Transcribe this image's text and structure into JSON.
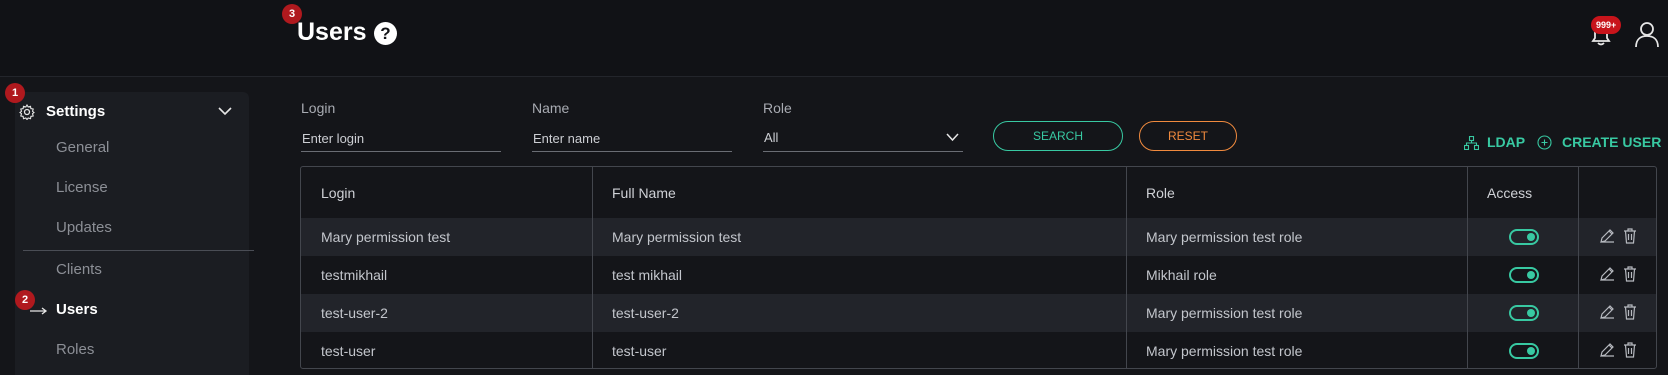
{
  "header": {
    "title": "Users",
    "notifications_count": "999+"
  },
  "annotations": [
    "1",
    "2",
    "3"
  ],
  "sidebar": {
    "section_title": "Settings",
    "items": [
      {
        "label": "General"
      },
      {
        "label": "License"
      },
      {
        "label": "Updates"
      },
      {
        "label": "Clients"
      },
      {
        "label": "Users"
      },
      {
        "label": "Roles"
      }
    ]
  },
  "filters": {
    "login_label": "Login",
    "login_placeholder": "Enter login",
    "name_label": "Name",
    "name_placeholder": "Enter name",
    "role_label": "Role",
    "role_value": "All",
    "search_label": "SEARCH",
    "reset_label": "RESET"
  },
  "actions": {
    "ldap_label": "LDAP",
    "create_user_label": "CREATE USER"
  },
  "table": {
    "columns": [
      "Login",
      "Full Name",
      "Role",
      "Access"
    ],
    "rows": [
      {
        "login": "Mary permission test",
        "full_name": "Mary permission test",
        "role": "Mary permission test role",
        "access": true
      },
      {
        "login": "testmikhail",
        "full_name": "test mikhail",
        "role": "Mikhail role",
        "access": true
      },
      {
        "login": "test-user-2",
        "full_name": "test-user-2",
        "role": "Mary permission test role",
        "access": true
      },
      {
        "login": "test-user",
        "full_name": "test-user",
        "role": "Mary permission test role",
        "access": true
      }
    ]
  },
  "colors": {
    "accent": "#38c9a2",
    "reset": "#f08a3e",
    "badge": "#b0191e"
  }
}
